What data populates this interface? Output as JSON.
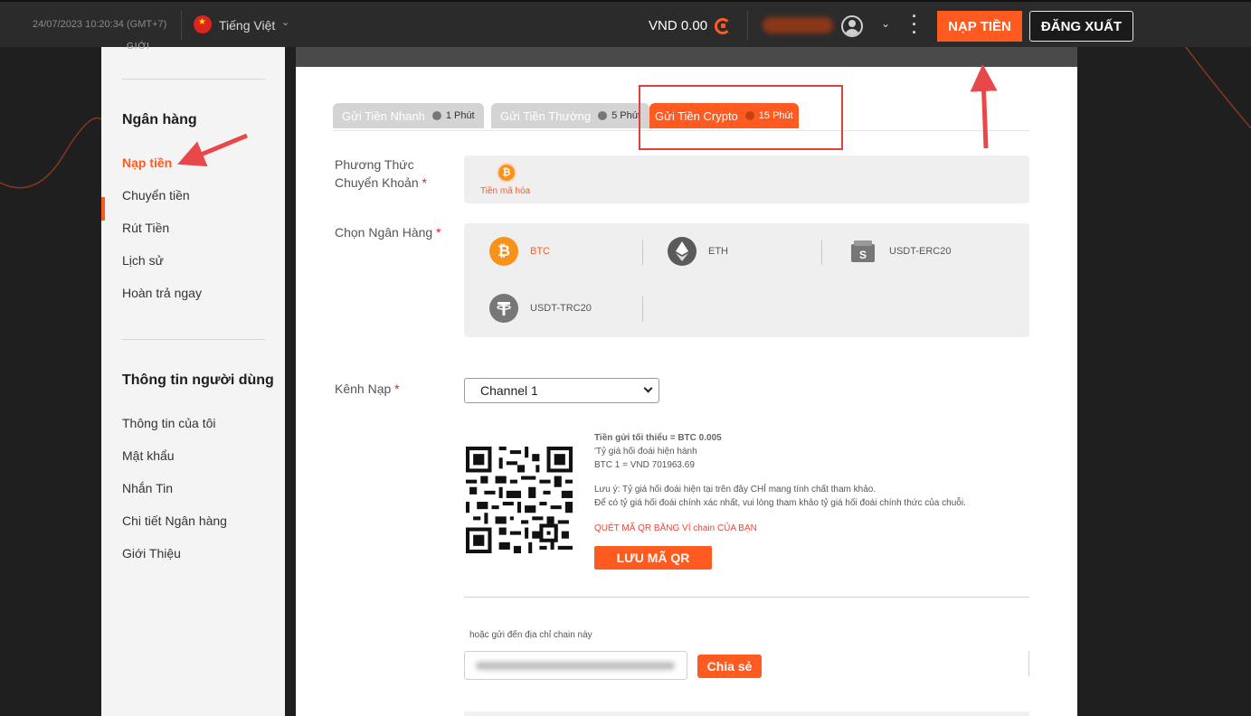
{
  "topbar": {
    "datetime": "24/07/2023 10:20:34 (GMT+7)",
    "language": "Tiếng Việt",
    "balance": "VND 0.00",
    "deposit_button": "NẠP TIỀN",
    "logout_button": "ĐĂNG XUẤT"
  },
  "sidebar": {
    "top_text": "GIỚI",
    "sections": [
      {
        "heading": "Ngân hàng",
        "items": [
          "Nạp tiền",
          "Chuyển tiền",
          "Rút Tiền",
          "Lịch sử",
          "Hoàn trả ngay"
        ]
      },
      {
        "heading": "Thông tin người dùng",
        "items": [
          "Thông tin của tôi",
          "Mật khẩu",
          "Nhắn Tin",
          "Chi tiết Ngân hàng",
          "Giới Thiệu"
        ]
      }
    ],
    "active_item": "Nạp tiền"
  },
  "tabs": [
    {
      "name": "Gửi Tiền Nhanh",
      "time": "1 Phút",
      "active": false
    },
    {
      "name": "Gửi Tiền Thường",
      "time": "5 Phút",
      "active": false
    },
    {
      "name": "Gửi Tiền Crypto",
      "time": "15 Phút",
      "active": true
    }
  ],
  "form": {
    "transfer_method_label_1": "Phương Thức",
    "transfer_method_label_2": "Chuyển Khoản",
    "transfer_method_option": "Tiền mã hóa",
    "bank_label": "Chọn Ngân Hàng",
    "banks": [
      {
        "name": "BTC",
        "icon": "bitcoin-icon",
        "color": "#f7931a",
        "active": true
      },
      {
        "name": "ETH",
        "icon": "ethereum-icon",
        "color": "#5a5a5a",
        "active": false
      },
      {
        "name": "USDT-ERC20",
        "icon": "wallet-icon",
        "color": "#777777",
        "active": false
      },
      {
        "name": "USDT-TRC20",
        "icon": "tether-icon",
        "color": "#777777",
        "active": false
      }
    ],
    "channel_label": "Kênh Nạp",
    "channel_value": "Channel 1",
    "required_mark": "*"
  },
  "qr_info": {
    "min_deposit": "Tiền gửi tối thiểu = BTC 0.005",
    "rate_title": "'Tỷ giá hối đoái hiện hành",
    "rate_value": "BTC 1 = VND 701963.69",
    "note_1": "Lưu ý: Tỷ giá hối đoái hiện tại trên đây CHỈ mang tính chất tham khảo.",
    "note_2": "Để có tỷ giá hối đoái chính xác nhất, vui lòng tham khảo tỷ giá hối đoái chính thức của chuỗi.",
    "scan_text": "QUÉT MÃ QR BẰNG VÍ chain CỦA BẠN",
    "save_qr_button": "LƯU MÃ QR"
  },
  "address": {
    "label": "hoặc gửi đến địa chỉ chain này",
    "share_button": "Chia sẻ"
  },
  "colors": {
    "accent": "#ff5a1f",
    "topbar": "#2b2b2b",
    "highlight": "#e43d3d"
  }
}
